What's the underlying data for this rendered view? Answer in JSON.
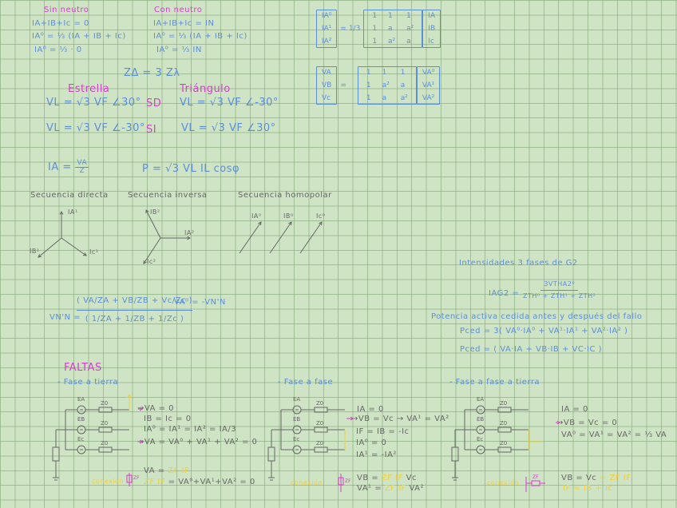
{
  "sin_neutro": {
    "title": "Sin neutro",
    "lines": [
      "IA+IB+Ic = 0",
      "IA⁰ = ⅓ (IA + IB + Ic)",
      "IA⁰ = ⅓ · 0"
    ]
  },
  "con_neutro": {
    "title": "Con neutro",
    "lines": [
      "IA+IB+Ic = IN",
      "IA⁰ = ⅓ (IA + IB + Ic)",
      "IA⁰ = ⅓ IN"
    ]
  },
  "z_delta": "ZΔ = 3 Zλ",
  "connections": {
    "estrella": "Estrella",
    "triangulo": "Triángulo",
    "sd": "SD",
    "si": "SI",
    "sd_estrella": "VL = √3 VF ∠30°",
    "sd_triangulo": "VL = √3 VF ∠-30°",
    "si_estrella": "VL = √3 VF ∠-30°",
    "si_triangulo": "VL = √3 VF ∠30°"
  },
  "matrix1": {
    "lhs": [
      "IA⁰",
      "IA¹",
      "IA²"
    ],
    "factor": "1/3",
    "m": [
      "1",
      "1",
      "1",
      "1",
      "a",
      "a²",
      "1",
      "a²",
      "a"
    ],
    "rhs": [
      "IA",
      "IB",
      "Ic"
    ]
  },
  "matrix2": {
    "lhs": [
      "VA",
      "VB",
      "Vc"
    ],
    "m": [
      "1",
      "1",
      "1",
      "1",
      "a²",
      "a",
      "1",
      "a",
      "a²"
    ],
    "rhs": [
      "VA⁰",
      "VA¹",
      "VA²"
    ]
  },
  "ohm": {
    "lhs": "IA =",
    "num": "VA",
    "den": "Z"
  },
  "power": "P = √3 VL IL cosφ",
  "sequences": {
    "directa": {
      "title": "Secuencia directa",
      "labels": [
        "IA¹",
        "IB¹",
        "Ic¹"
      ]
    },
    "inversa": {
      "title": "Secuencia inversa",
      "labels": [
        "IB²",
        "IA²",
        "Ic²"
      ]
    },
    "homopolar": {
      "title": "Secuencia homopolar",
      "labels": [
        "IA⁰",
        "IB⁰",
        "Ic⁰"
      ]
    }
  },
  "vnn": {
    "lhs": "VN'N =",
    "num": "( VA/ZA + VB/ZB + Vc/Zc )",
    "den": "( 1/ZA + 1/ZB + 1/Zc )",
    "note": "VA⁰ = -VN'N"
  },
  "g2": {
    "title": "Intensidades 3 fases de G2",
    "ia_lhs": "IAG2 =",
    "ia_num": "3VTHA2⁰",
    "ia_den": "ZTH⁰ + ZTH¹ + ZTH²",
    "power_title": "Potencia activa cedida  antes y después del fallo",
    "p1": "Pced = 3( VA⁰·IA⁰ + VA¹·IA¹ + VA²·IA² )",
    "p2": "Pced = ( VA·IA + VB·IB + VC·IC )"
  },
  "faltas": {
    "title": "FALTAS",
    "circuit_labels": {
      "ea": "EA",
      "eb": "EB",
      "ec": "Ec",
      "z": "Z0",
      "zf": "ZF"
    },
    "fase_tierra": {
      "title": "- Fase a tierra",
      "lines": [
        "→VA = 0",
        "IB = Ic = 0",
        "IA⁰ = IA¹ = IA² = IA/3",
        "→VA = VA⁰ + VA¹ + VA² = 0"
      ],
      "bottom1": "VA =",
      "bottom1_y": "ZF IF",
      "bottom2_y": "ZF IF",
      "bottom2": "= VA⁰+VA¹+VA² = 0",
      "side": "conexión"
    },
    "fase_fase": {
      "title": "- Fase a fase",
      "lines": [
        "IA = 0",
        "→VB = Vc → VA¹ = VA²",
        "IF = IB = -Ic",
        "IA⁰ = 0",
        "IA¹ = -IA²"
      ],
      "bottom1": "VB =",
      "bottom1_y": "ZF IF",
      "bottom1_end": "Vc",
      "bottom2": "VA¹ =",
      "bottom2_y": "ZF IF",
      "bottom2_end": "VA²",
      "side": "conexión"
    },
    "fase_fase_tierra": {
      "title": "- Fase a fase a tierra",
      "lines": [
        "IA = 0",
        "→VB = Vc = 0",
        "VA⁰ = VA¹ = VA² = ⅓ VA"
      ],
      "bottom1": "VB = Vc",
      "bottom1_y": "= ZF IF",
      "bottom2_y": "IF = IB + Ic",
      "side": "conexión"
    }
  },
  "colors": {
    "pink": "#d53fc9",
    "blue": "#5b8fd8",
    "gray": "#666666",
    "yellow": "#f2cf3a",
    "paper": "#cfe4c5"
  }
}
